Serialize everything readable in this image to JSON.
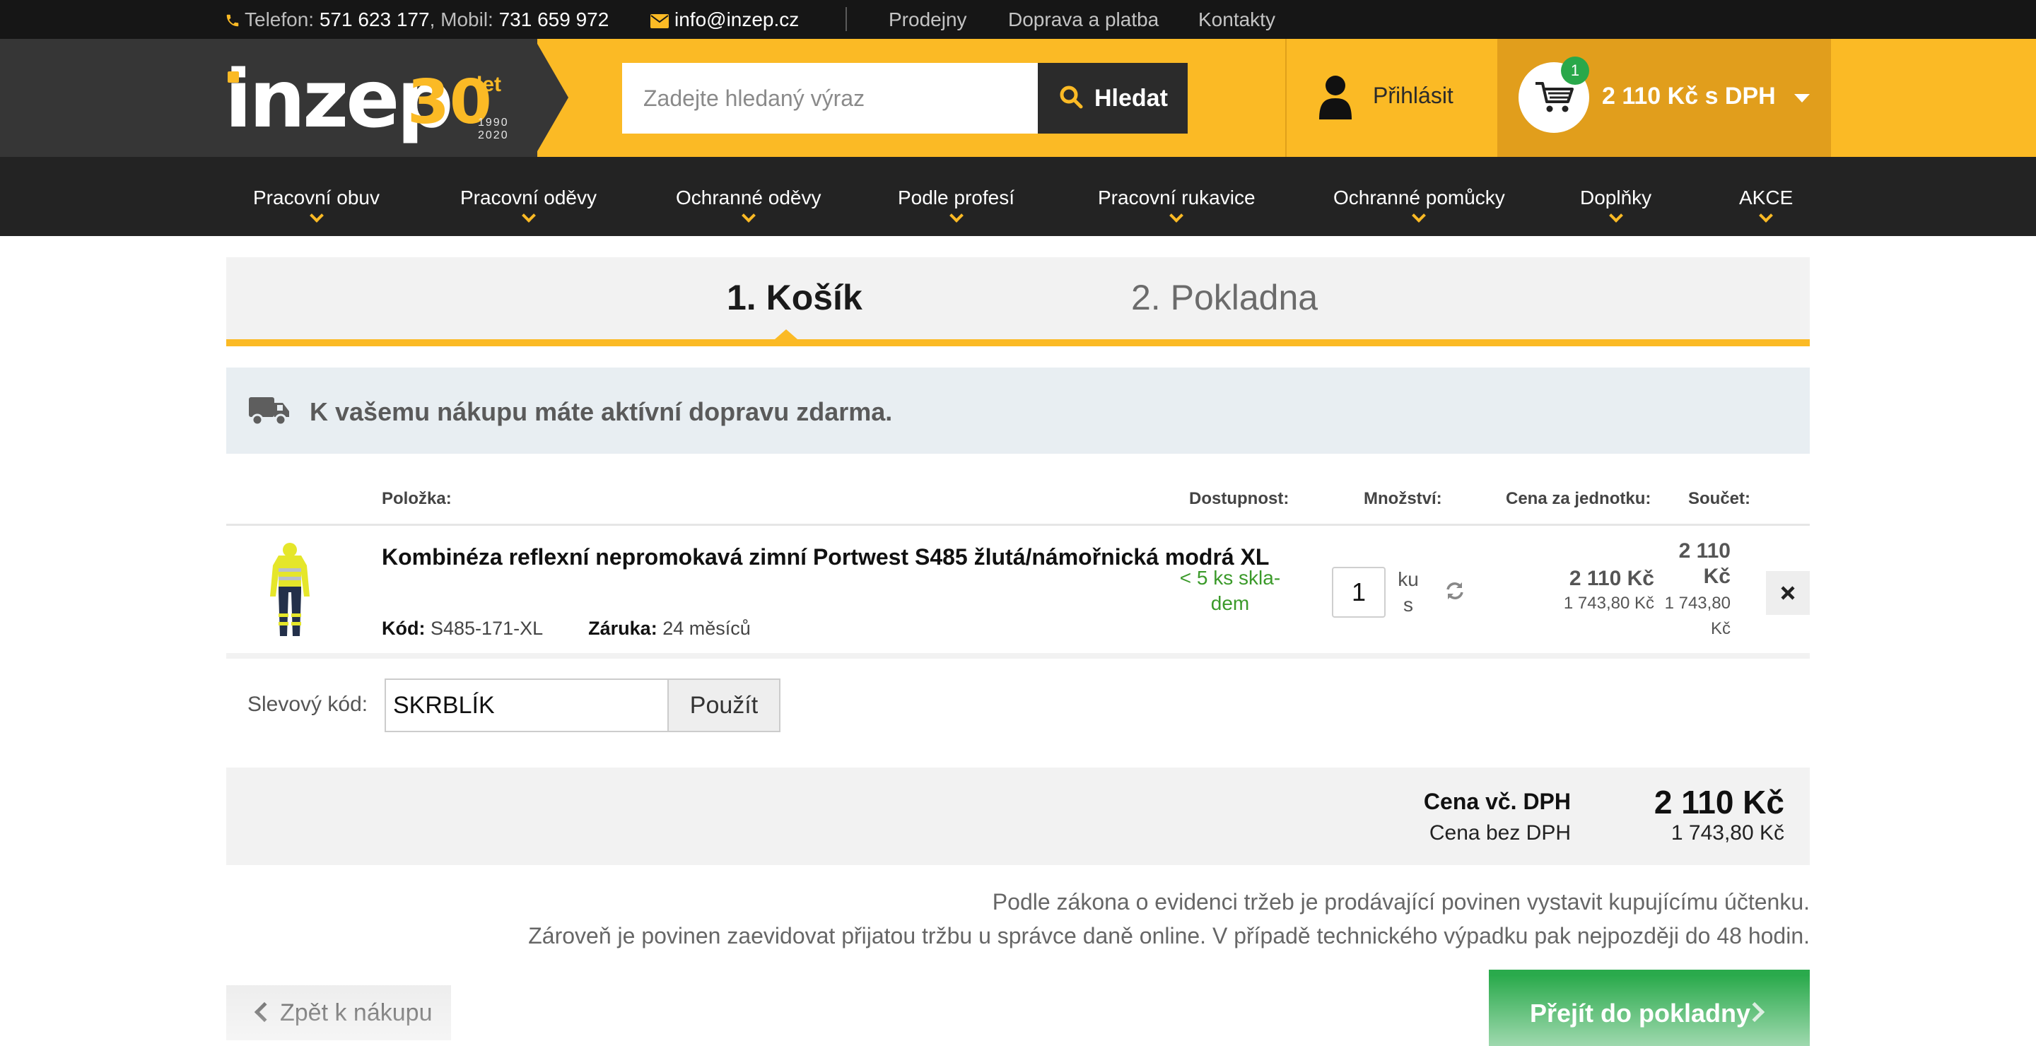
{
  "topbar": {
    "phone_label": "Telefon:",
    "phone": "571 623 177",
    "mobile_label": ", Mobil:",
    "mobile": "731 659 972",
    "email": "info@inzep.cz",
    "links": [
      "Prodejny",
      "Doprava a platba",
      "Kontakty"
    ]
  },
  "header": {
    "logo": {
      "word": "inzep",
      "number": "30",
      "suffix": "let",
      "years_from": "1990",
      "years_to": "2020"
    },
    "search": {
      "placeholder": "Zadejte hledaný výraz",
      "button": "Hledat"
    },
    "login_label": "Přihlásit",
    "cart": {
      "count": "1",
      "total": "2 110 Kč s DPH"
    }
  },
  "nav": [
    "Pracovní obuv",
    "Pracovní oděvy",
    "Ochranné oděvy",
    "Podle profesí",
    "Pracovní rukavice",
    "Ochranné pomůcky",
    "Doplňky",
    "AKCE"
  ],
  "steps": {
    "step1": "1. Košík",
    "step2": "2. Pokladna"
  },
  "notice": "K vašemu nákupu máte aktívní dopravu zdarma.",
  "table": {
    "headers": {
      "item": "Položka:",
      "availability": "Dostupnost:",
      "quantity": "Množství:",
      "unit_price": "Cena za jednotku:",
      "sum": "Součet:"
    },
    "rows": [
      {
        "name": "Kombinéza reflexní nepromokavá zimní Portwest S485 žlutá/námořnická modrá XL",
        "code_label": "Kód:",
        "code": "S485-171-XL",
        "warranty_label": "Záruka:",
        "warranty": "24 měsíců",
        "availability": "< 5 ks skla-dem",
        "quantity": "1",
        "unit": "ku s",
        "unit_price": "2 110 Kč",
        "unit_price_net": "1 743,80 Kč",
        "sum": "2 110 Kč",
        "sum_net": "1 743,80 Kč"
      }
    ]
  },
  "voucher": {
    "label": "Slevový kód:",
    "value": "SKRBLÍK",
    "button": "Použít"
  },
  "totals": {
    "with_vat_label": "Cena vč. DPH",
    "with_vat": "2 110 Kč",
    "without_vat_label": "Cena bez DPH",
    "without_vat": "1 743,80 Kč"
  },
  "legal": {
    "line1": "Podle zákona o evidenci tržeb je prodávající povinen vystavit kupujícímu účtenku.",
    "line2": "Zároveň je povinen zaevidovat přijatou tržbu u správce daně online. V případě technického výpadku pak nejpozději do 48 hodin."
  },
  "actions": {
    "back": "Zpět k nákupu",
    "checkout": "Přejít do pokladny"
  },
  "colors": {
    "brand_yellow": "#fbba25",
    "cart_orange": "#e19e1c",
    "dark": "#232323",
    "green": "#2aaa4c",
    "stock_green": "#3b9a2a"
  },
  "icons": [
    "phone-icon",
    "mail-icon",
    "search-icon",
    "user-icon",
    "cart-icon",
    "truck-icon",
    "refresh-icon",
    "close-icon",
    "chevron-down-icon",
    "chevron-left-icon",
    "chevron-right-icon"
  ]
}
